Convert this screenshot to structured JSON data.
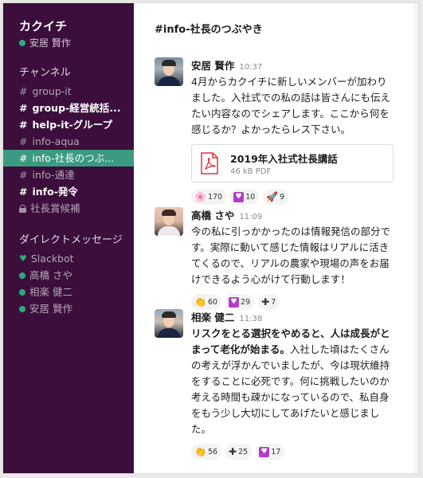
{
  "sidebar": {
    "team_name": "カクイチ",
    "current_user": "安居 賢作",
    "channels_title": "チャンネル",
    "channels": [
      {
        "name": "group-it",
        "style": "normal",
        "icon": "hash"
      },
      {
        "name": "group-経営統括...",
        "style": "bold",
        "icon": "hash"
      },
      {
        "name": "help-it-グループ",
        "style": "bold",
        "icon": "hash"
      },
      {
        "name": "info-aqua",
        "style": "normal",
        "icon": "hash"
      },
      {
        "name": "info-社長のつぶ...",
        "style": "active",
        "icon": "hash"
      },
      {
        "name": "info-通達",
        "style": "normal",
        "icon": "hash"
      },
      {
        "name": "info-発令",
        "style": "bold",
        "icon": "hash"
      },
      {
        "name": "社長賞候補",
        "style": "normal",
        "icon": "lock"
      }
    ],
    "dm_title": "ダイレクトメッセージ",
    "dms": [
      {
        "name": "Slackbot",
        "icon": "heart-icon"
      },
      {
        "name": "高橋 さや",
        "icon": "presence-dot"
      },
      {
        "name": "相楽 健二",
        "icon": "presence-dot"
      },
      {
        "name": "安居 賢作",
        "icon": "presence-dot"
      }
    ],
    "hash_glyph": "#"
  },
  "main": {
    "channel_title": "#info-社長のつぶやき",
    "messages": [
      {
        "author": "安居 賢作",
        "time": "10:37",
        "text": "4月からカクイチに新しいメンバーが加わりました。入社式での私の話は皆さんにも伝えたい内容なのでシェアします。ここから何を感じるか？よかったらレス下さい。",
        "file": {
          "name": "2019年入社式社長講話",
          "meta": "46 kB PDF"
        },
        "reactions": [
          {
            "emoji": "🌸",
            "count": "170"
          },
          {
            "emoji": "heart",
            "count": "10"
          },
          {
            "emoji": "🚀",
            "count": "9"
          }
        ]
      },
      {
        "author": "高橋 さや",
        "time": "11:09",
        "text": "今の私に引っかかったのは情報発信の部分です。実際に動いて感じた情報はリアルに活きてくるので、リアルの農家や現場の声をお届けできるよう心がけて行動します！",
        "reactions": [
          {
            "emoji": "👏",
            "count": "60"
          },
          {
            "emoji": "heart",
            "count": "29"
          },
          {
            "emoji": "➕",
            "count": "7"
          }
        ]
      },
      {
        "author": "相楽 健二",
        "time": "11:38",
        "text_bold": "リスクをとる選択をやめると、人は成長がとまって老化が始まる。",
        "text": "入社した頃はたくさんの考えが浮かんでいましたが、今は現状維持をすることに必死です。何に挑戦したいのか考える時間も疎かになっているので、私自身をもう少し大切にしてあげたいと感じました。",
        "reactions": [
          {
            "emoji": "👏",
            "count": "56"
          },
          {
            "emoji": "➕",
            "count": "25"
          },
          {
            "emoji": "heart",
            "count": "17"
          }
        ]
      }
    ]
  },
  "colors": {
    "sidebar_bg": "#3b0e3c",
    "active_channel": "#3b9b82",
    "presence": "#2bac76",
    "heart_reaction": "#b13fc4",
    "pdf_red": "#e0303a"
  }
}
